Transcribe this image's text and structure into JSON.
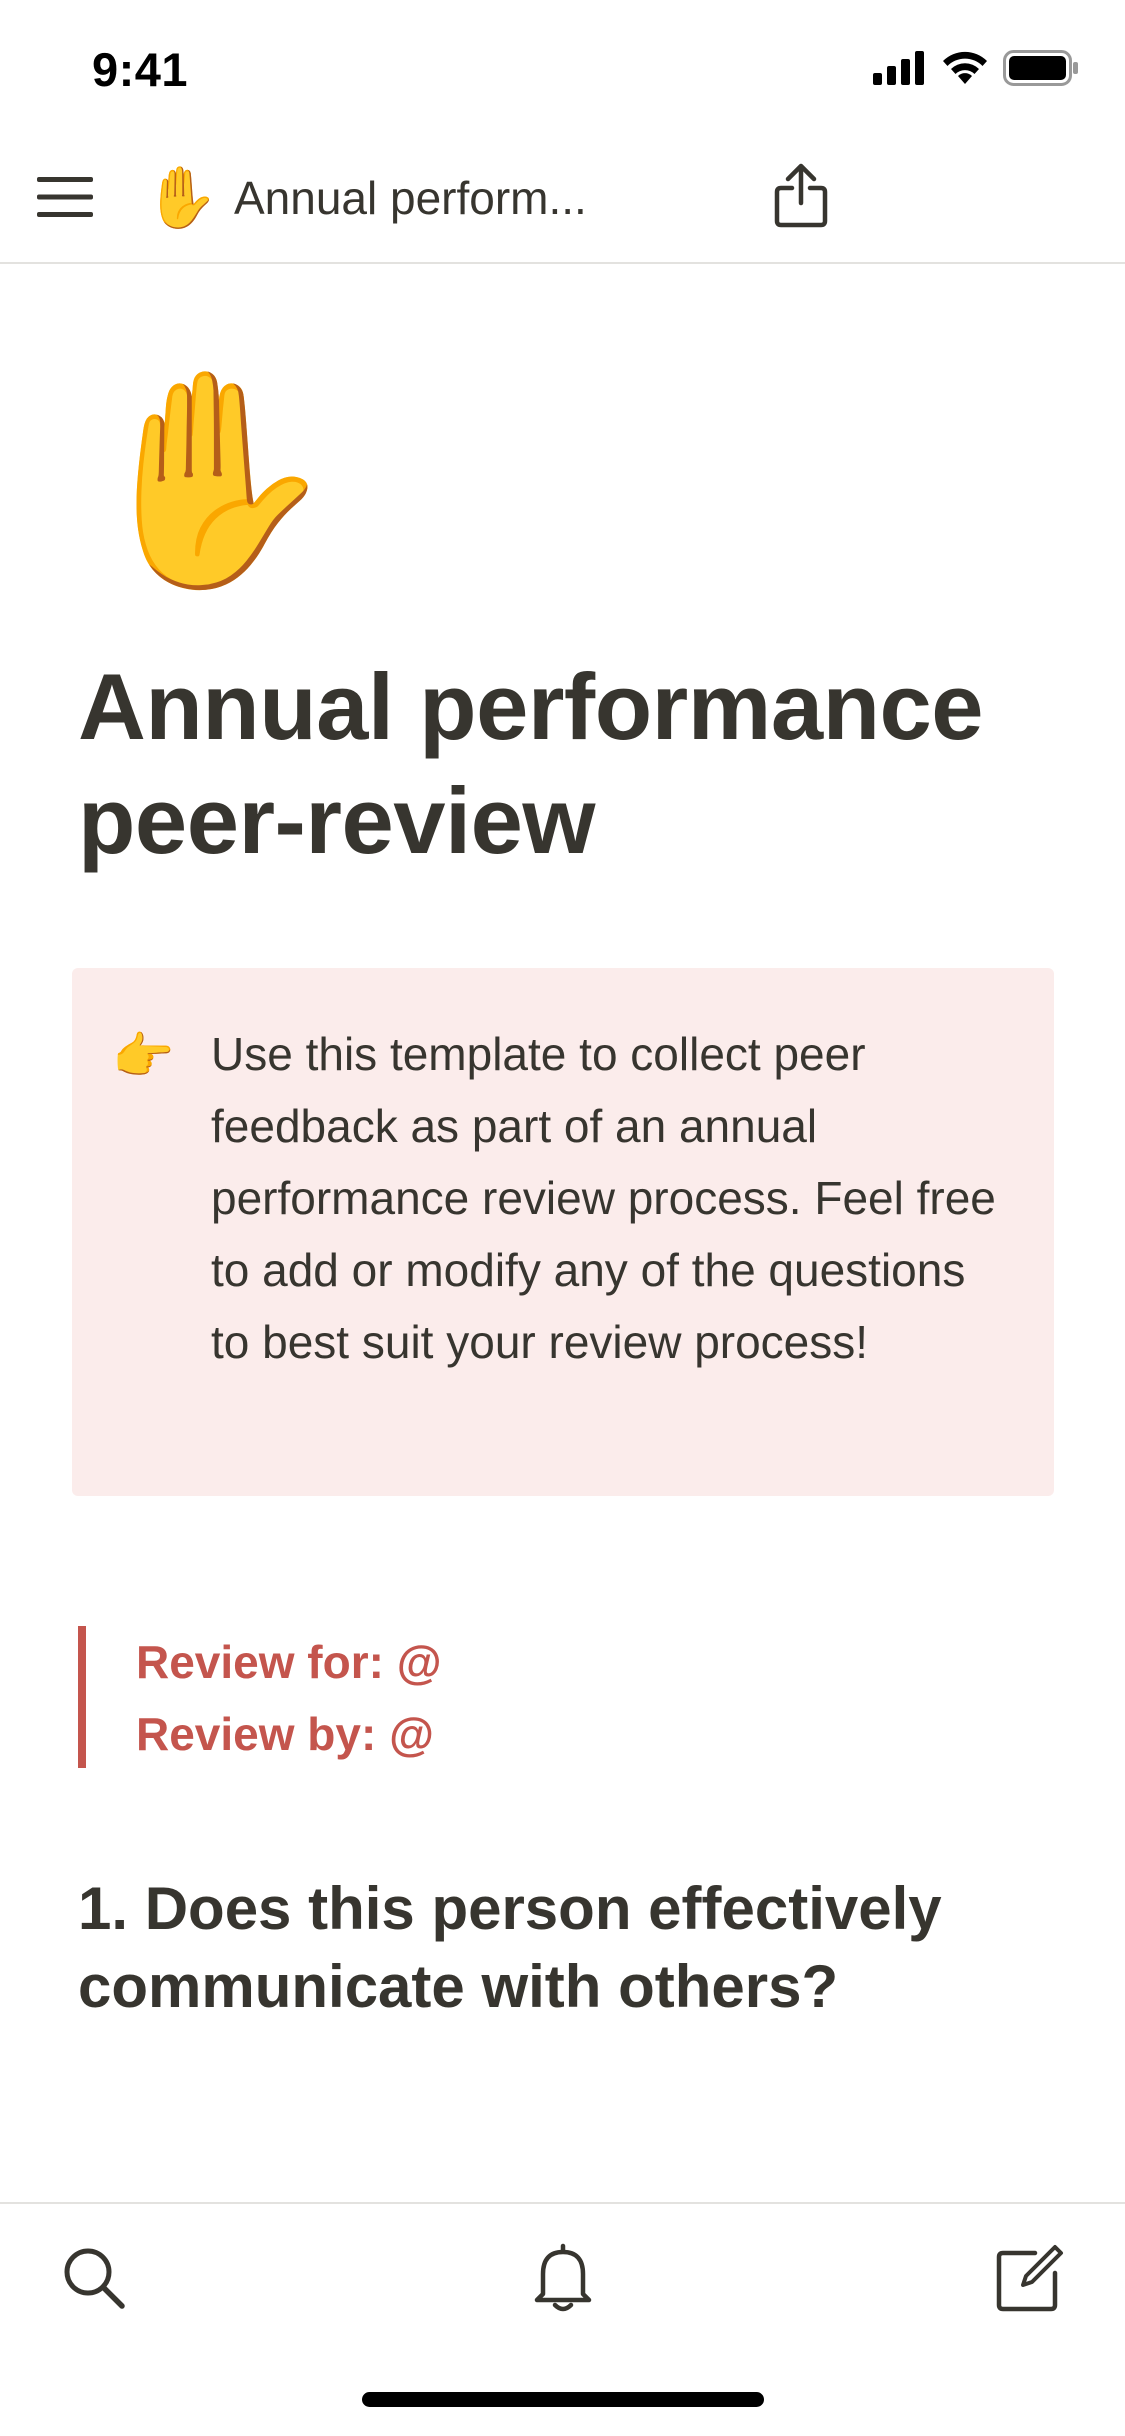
{
  "status_bar": {
    "time": "9:41",
    "icons": [
      "cellular-signal-icon",
      "wifi-icon",
      "battery-icon"
    ]
  },
  "nav": {
    "menu_icon": "hamburger-menu-icon",
    "page_emoji": "✋",
    "page_title": "Annual perform...",
    "share_icon": "share-icon"
  },
  "page": {
    "emoji": "✋",
    "title": "Annual performance peer-review",
    "callout": {
      "icon": "👉",
      "text": "Use this template to collect peer feedback as part of an annual performance review process. Feel free to add or modify any of the questions to best suit your review process!",
      "background": "#fbeceb"
    },
    "quote": {
      "line1": "Review for: @",
      "line2": "Review by: @",
      "color": "#c4554d"
    },
    "question": "1. Does this person effectively communicate with others?"
  },
  "bottom_bar": {
    "items": [
      "search-icon",
      "bell-icon",
      "compose-icon"
    ]
  }
}
